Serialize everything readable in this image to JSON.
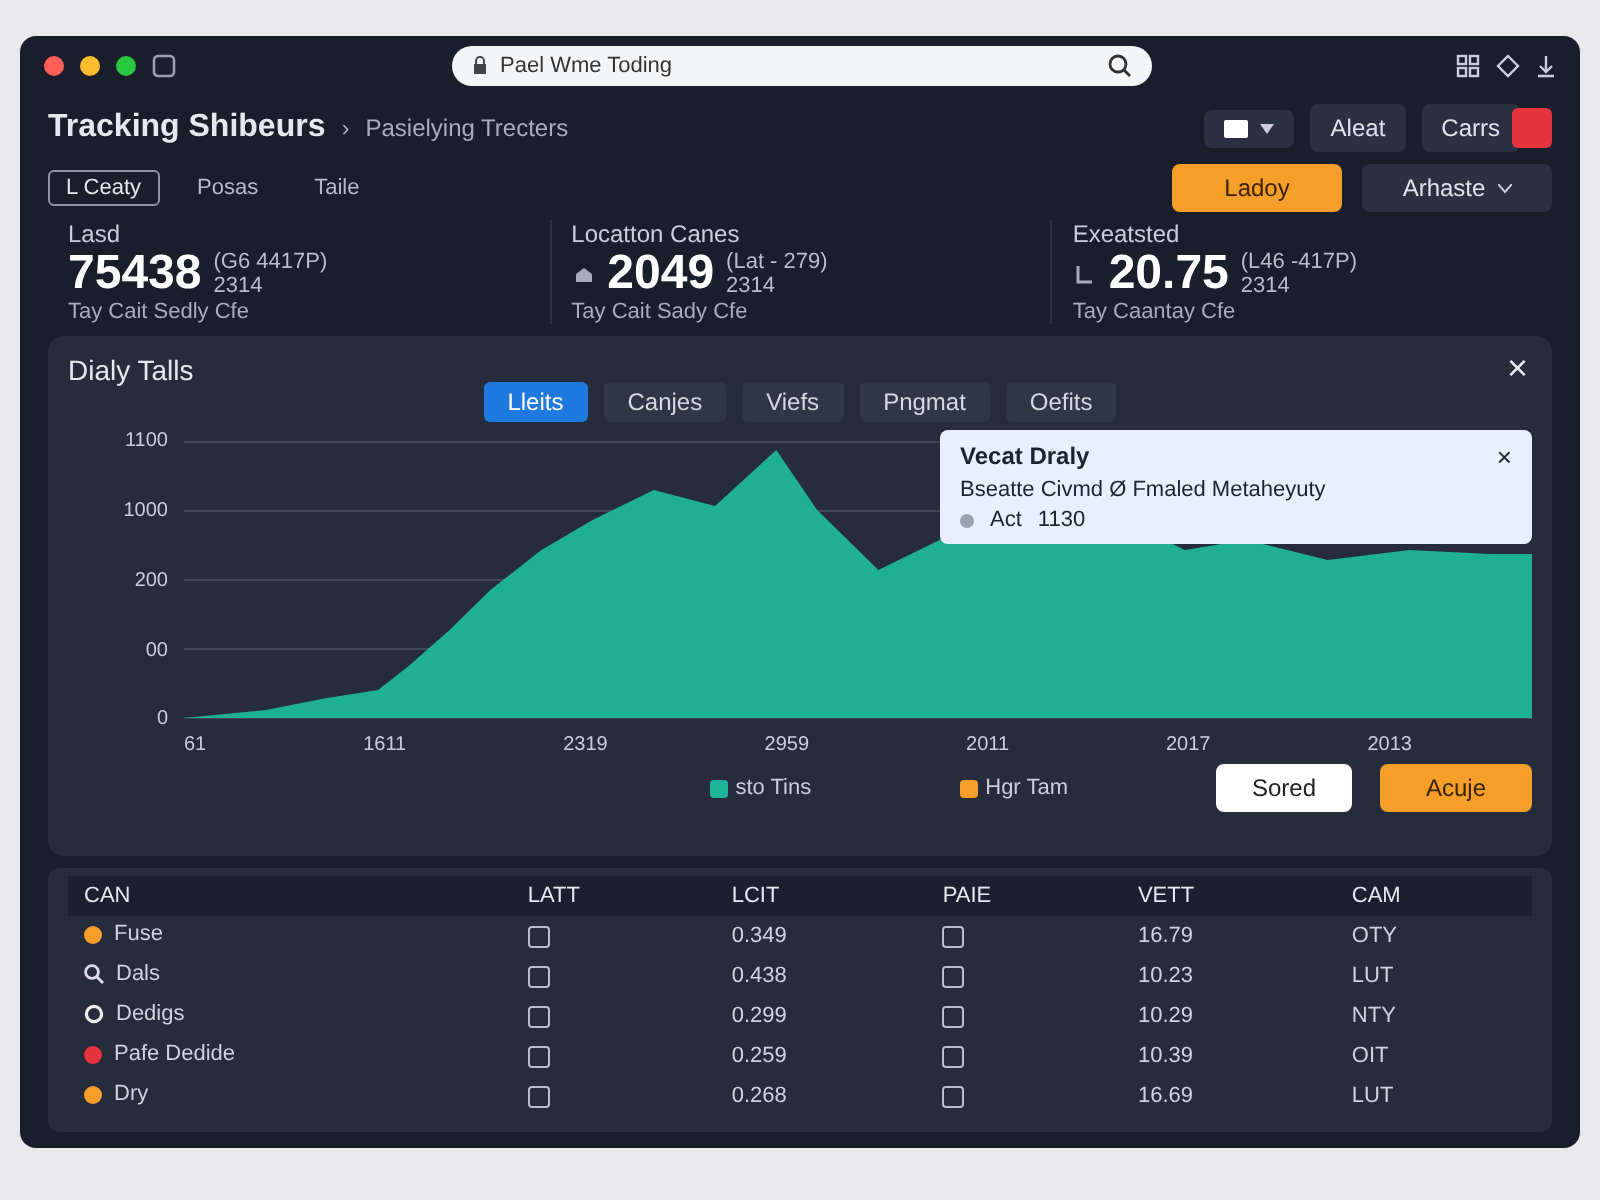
{
  "browser": {
    "address": "Pael Wme Toding"
  },
  "header": {
    "title": "Tracking Shibeurs",
    "separator": "›",
    "subtitle": "Pasielying Trecters",
    "buttons": [
      "Aleat",
      "Carrs"
    ]
  },
  "toolbar": {
    "filters": [
      {
        "label": "L Ceaty",
        "selected": true
      },
      {
        "label": "Posas",
        "selected": false
      },
      {
        "label": "Taile",
        "selected": false
      }
    ],
    "primary": "Ladoy",
    "menu": "Arhaste"
  },
  "stats": [
    {
      "label": "Lasd",
      "value": "75438",
      "delta": "(G6 4417P)",
      "sub": "2314",
      "caption": "Tay Cait Sedly Cfe"
    },
    {
      "label": "Locatton Canes",
      "value": "2049",
      "delta": "(Lat - 279)",
      "sub": "2314",
      "caption": "Tay Cait Sady Cfe"
    },
    {
      "label": "Exeatsted",
      "value": "20.75",
      "delta": "(L46 -417P)",
      "sub": "2314",
      "caption": "Tay Caantay Cfe"
    }
  ],
  "panel": {
    "title": "Dialy Talls",
    "close": "×",
    "tabs": [
      {
        "label": "Lleits",
        "selected": true
      },
      {
        "label": "Canjes",
        "selected": false
      },
      {
        "label": "Viefs",
        "selected": false
      },
      {
        "label": "Pngmat",
        "selected": false
      },
      {
        "label": "Oefits",
        "selected": false
      }
    ],
    "y_labels": [
      "1100",
      "1000",
      "200",
      "00",
      "0"
    ],
    "x_labels": [
      "61",
      "1611",
      "2319",
      "2959",
      "2011",
      "2017",
      "2013"
    ],
    "tooltip": {
      "title": "Vecat Draly",
      "text": "Bseatte Civmd Ø Fmaled Metaheyuty",
      "close": "×",
      "item_label": "Act",
      "item_value": "1130"
    },
    "legend": [
      {
        "label": "sto Tins",
        "color": "#1fb59a"
      },
      {
        "label": "Hgr Tam",
        "color": "#f59e2a"
      }
    ],
    "buttons": [
      {
        "label": "Sored",
        "kind": "secondary"
      },
      {
        "label": "Acuje",
        "kind": "primary"
      }
    ]
  },
  "table": {
    "columns": [
      "CAN",
      "LATT",
      "LCIT",
      "PAIE",
      "VETT",
      "CAM"
    ],
    "rows": [
      {
        "kind": "dot",
        "color": "#f59e2a",
        "name": "Fuse",
        "latt": false,
        "lcit": "0.349",
        "paie": false,
        "vett": "16.79",
        "cam": "OTY"
      },
      {
        "kind": "search",
        "name": "Dals",
        "latt": false,
        "lcit": "0.438",
        "paie": false,
        "vett": "10.23",
        "cam": "LUT"
      },
      {
        "kind": "ring",
        "name": "Dedigs",
        "latt": false,
        "lcit": "0.299",
        "paie": false,
        "vett": "10.29",
        "cam": "NTY"
      },
      {
        "kind": "dot",
        "color": "#e5333f",
        "name": "Pafe Dedide",
        "latt": false,
        "lcit": "0.259",
        "paie": false,
        "vett": "10.39",
        "cam": "OIT"
      },
      {
        "kind": "dot",
        "color": "#f59e2a",
        "name": "Dry",
        "latt": false,
        "lcit": "0.268",
        "paie": false,
        "vett": "16.69",
        "cam": "LUT"
      }
    ]
  }
}
